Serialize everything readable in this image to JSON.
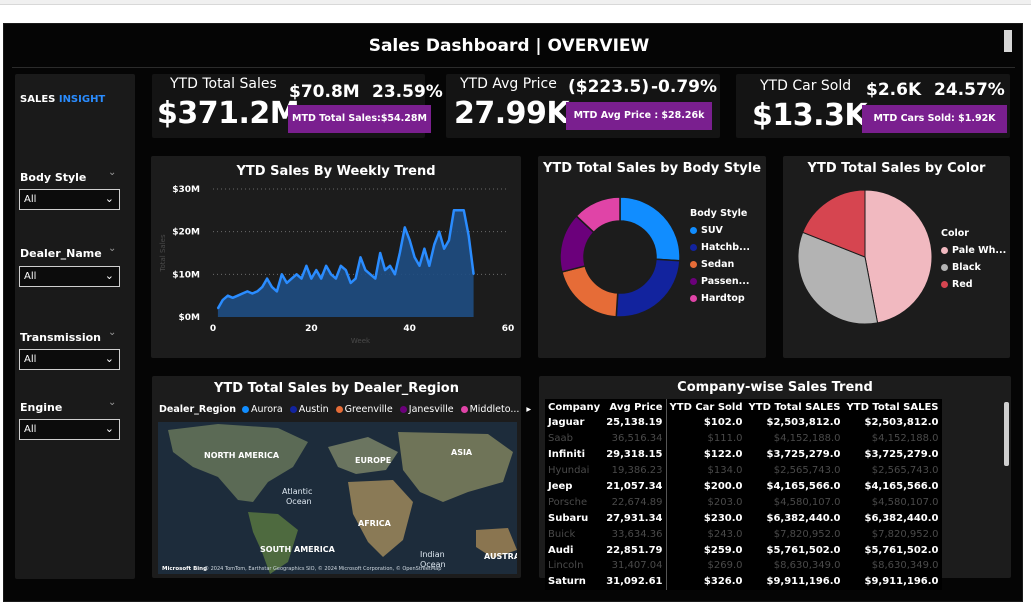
{
  "dashboard": {
    "title": "Sales Dashboard | OVERVIEW"
  },
  "sidebar": {
    "brand_part1": "SALES",
    "brand_part2": "INSIGHT",
    "filters": [
      {
        "label": "Body Style",
        "value": "All"
      },
      {
        "label": "Dealer_Name",
        "value": "All"
      },
      {
        "label": "Transmission",
        "value": "All"
      },
      {
        "label": "Engine",
        "value": "All"
      }
    ]
  },
  "kpis": [
    {
      "label": "YTD Total Sales",
      "big": "$371.2M",
      "value1": "$70.8M",
      "value2": "23.59%",
      "mtd": "MTD Total Sales:$54.28M"
    },
    {
      "label": "YTD Avg Price",
      "big": "27.99K",
      "value1": "($223.5)",
      "value2": "-0.79%",
      "mtd": "MTD Avg Price : $28.26k"
    },
    {
      "label": "YTD Car Sold",
      "big": "$13.3K",
      "value1": "$2.6K",
      "value2": "24.57%",
      "mtd": "MTD Cars Sold: $1.92K"
    }
  ],
  "charts": {
    "weekly": {
      "title": "YTD Sales By Weekly Trend",
      "y_ticks": [
        "$30M",
        "$20M",
        "$10M",
        "$0M"
      ],
      "x_ticks": [
        "0",
        "20",
        "40",
        "60"
      ],
      "xlabel": "Week",
      "ylabel": "Total Sales"
    },
    "body_style": {
      "title": "YTD Total Sales by Body Style",
      "legend_title": "Body Style",
      "items": [
        "SUV",
        "Hatchb...",
        "Sedan",
        "Passen...",
        "Hardtop"
      ]
    },
    "color": {
      "title": "YTD Total Sales by Color",
      "legend_title": "Color",
      "items": [
        "Pale Wh...",
        "Black",
        "Red"
      ]
    },
    "region": {
      "title": "YTD Total Sales by Dealer_Region",
      "legend_title": "Dealer_Region",
      "items": [
        "Aurora",
        "Austin",
        "Greenville",
        "Janesville",
        "Middleto..."
      ],
      "map_labels": [
        "NORTH AMERICA",
        "EUROPE",
        "ASIA",
        "Atlantic",
        "Ocean",
        "AFRICA",
        "SOUTH AMERICA",
        "Indian",
        "Ocean",
        "AUSTRA"
      ],
      "attribution": "© 2024 TomTom, Earthstar Geographics SIO, © 2024 Microsoft Corporation, © OpenStreetMap",
      "brand": "Microsoft Bing"
    },
    "company": {
      "title": "Company-wise Sales Trend",
      "columns": [
        "Company",
        "Avg Price",
        "YTD Car Sold",
        "YTD Total SALES",
        "YTD Total SALES"
      ],
      "rows": [
        [
          "Jaguar",
          "25,138.19",
          "$102.0",
          "$2,503,812.0",
          "$2,503,812.0"
        ],
        [
          "Saab",
          "36,516.34",
          "$111.0",
          "$4,152,188.0",
          "$4,152,188.0"
        ],
        [
          "Infiniti",
          "29,318.15",
          "$122.0",
          "$3,725,279.0",
          "$3,725,279.0"
        ],
        [
          "Hyundai",
          "19,386.23",
          "$134.0",
          "$2,565,743.0",
          "$2,565,743.0"
        ],
        [
          "Jeep",
          "21,057.34",
          "$200.0",
          "$4,165,566.0",
          "$4,165,566.0"
        ],
        [
          "Porsche",
          "22,674.89",
          "$203.0",
          "$4,580,107.0",
          "$4,580,107.0"
        ],
        [
          "Subaru",
          "27,931.34",
          "$230.0",
          "$6,382,440.0",
          "$6,382,440.0"
        ],
        [
          "Buick",
          "33,634.36",
          "$243.0",
          "$7,820,952.0",
          "$7,820,952.0"
        ],
        [
          "Audi",
          "22,851.79",
          "$259.0",
          "$5,761,502.0",
          "$5,761,502.0"
        ],
        [
          "Lincoln",
          "31,407.04",
          "$269.0",
          "$8,630,349.0",
          "$8,630,349.0"
        ],
        [
          "Saturn",
          "31,092.61",
          "$326.0",
          "$9,911,196.0",
          "$9,911,196.0"
        ]
      ]
    }
  },
  "chart_data": [
    {
      "type": "area",
      "title": "YTD Sales By Weekly Trend",
      "xlabel": "Week",
      "ylabel": "Total Sales",
      "ylim": [
        0,
        30
      ],
      "xlim": [
        0,
        60
      ],
      "y_unit": "$M",
      "x": [
        1,
        2,
        3,
        4,
        5,
        6,
        7,
        8,
        9,
        10,
        11,
        12,
        13,
        14,
        15,
        16,
        17,
        18,
        19,
        20,
        21,
        22,
        23,
        24,
        25,
        26,
        27,
        28,
        29,
        30,
        31,
        32,
        33,
        34,
        35,
        36,
        37,
        38,
        39,
        40,
        41,
        42,
        43,
        44,
        45,
        46,
        47,
        48,
        49,
        50,
        51,
        52,
        53
      ],
      "values": [
        2,
        4,
        5,
        4.5,
        5,
        5.5,
        6,
        5.5,
        6,
        7,
        9,
        7,
        6,
        10,
        8,
        9,
        10,
        9,
        12,
        9,
        11,
        9,
        12,
        10,
        9,
        12,
        11,
        8,
        9,
        14,
        11,
        10,
        9,
        15,
        11,
        12,
        10,
        15,
        21,
        18,
        14,
        12,
        16,
        12,
        17,
        20,
        16,
        18,
        25,
        25,
        25,
        19,
        10
      ]
    },
    {
      "type": "pie",
      "title": "YTD Total Sales by Body Style",
      "donut": true,
      "labels": [
        "SUV",
        "Hatchb...",
        "Sedan",
        "Passen...",
        "Hardtop"
      ],
      "values": [
        26,
        25,
        20,
        16,
        13
      ],
      "colors": [
        "#118dff",
        "#12239e",
        "#e66c37",
        "#6b007b",
        "#e044a7"
      ]
    },
    {
      "type": "pie",
      "title": "YTD Total Sales by Color",
      "labels": [
        "Pale Wh...",
        "Black",
        "Red"
      ],
      "values": [
        47,
        34,
        19
      ],
      "colors": [
        "#f1b9c0",
        "#b3b3b3",
        "#d64550"
      ]
    }
  ],
  "colors": {
    "accent_blue": "#2a8cff",
    "mtd_purple": "#7a1f8f",
    "region": [
      "#118dff",
      "#12239e",
      "#e66c37",
      "#6b007b",
      "#e044a7"
    ]
  }
}
